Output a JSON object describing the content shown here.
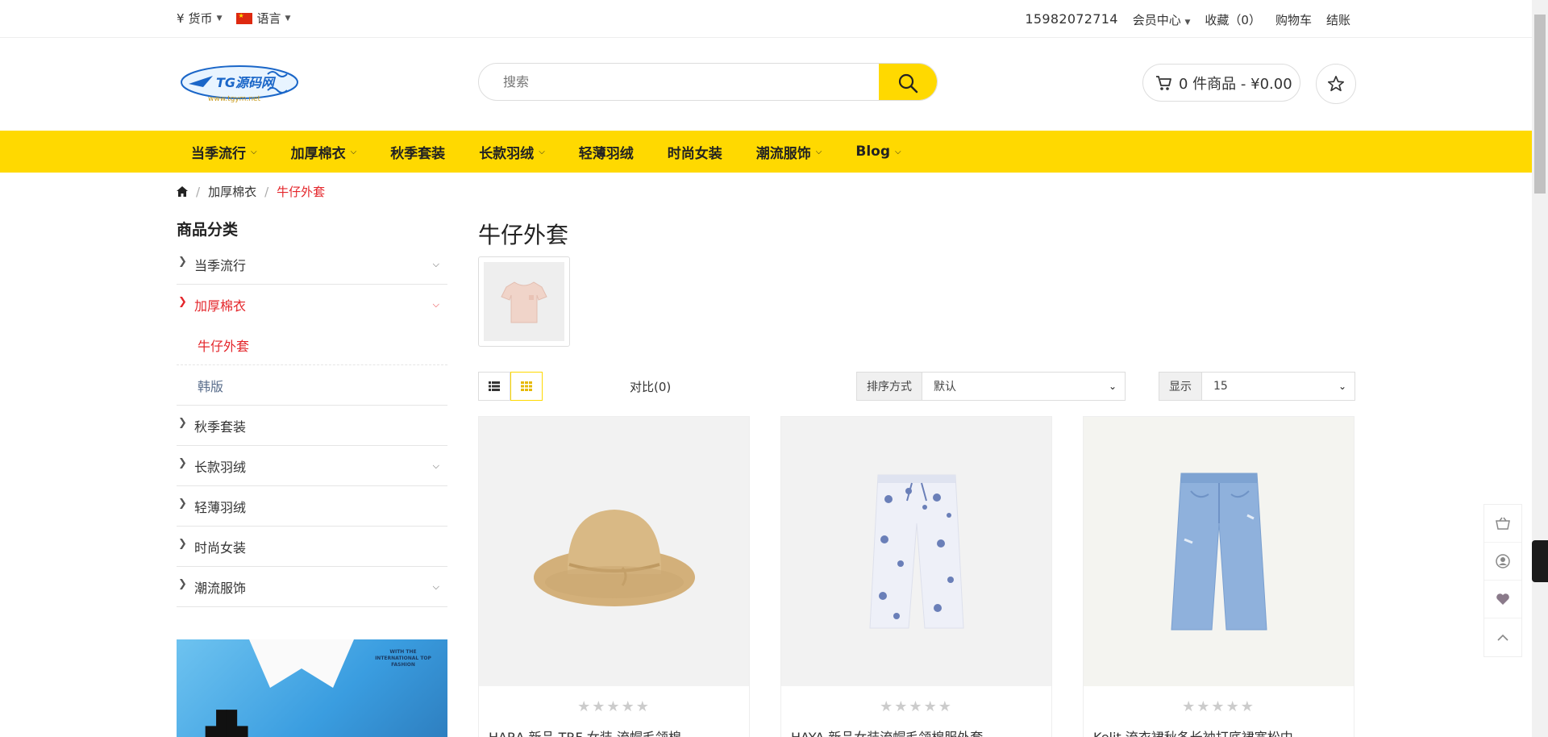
{
  "topbar": {
    "currency_symbol": "¥",
    "currency_label": "货币",
    "language_label": "语言",
    "phone": "15982072714",
    "member": "会员中心",
    "favorites": "收藏（0）",
    "cart": "购物车",
    "checkout": "结账"
  },
  "header": {
    "logo_text": "TG源码网",
    "logo_sub": "www.tgym.net",
    "search_placeholder": "搜索",
    "cart_summary": "0 件商品 - ¥0.00"
  },
  "nav": {
    "items": [
      {
        "label": "当季流行",
        "has_sub": true
      },
      {
        "label": "加厚棉衣",
        "has_sub": true
      },
      {
        "label": "秋季套装",
        "has_sub": false
      },
      {
        "label": "长款羽绒",
        "has_sub": true
      },
      {
        "label": "轻薄羽绒",
        "has_sub": false
      },
      {
        "label": "时尚女装",
        "has_sub": false
      },
      {
        "label": "潮流服饰",
        "has_sub": true
      },
      {
        "label": "Blog",
        "has_sub": true
      }
    ]
  },
  "breadcrumb": {
    "level1": "加厚棉衣",
    "level2": "牛仔外套"
  },
  "sidebar": {
    "title": "商品分类",
    "categories": [
      {
        "label": "当季流行"
      },
      {
        "label": "加厚棉衣"
      },
      {
        "label": "牛仔外套"
      },
      {
        "label": "韩版"
      },
      {
        "label": "秋季套装"
      },
      {
        "label": "长款羽绒"
      },
      {
        "label": "轻薄羽绒"
      },
      {
        "label": "时尚女装"
      },
      {
        "label": "潮流服饰"
      }
    ],
    "banner_text": "WITH THE INTERNATIONAL TOP FASHION"
  },
  "main": {
    "title": "牛仔外套",
    "compare": "对比(0)",
    "sort_label": "排序方式",
    "sort_value": "默认",
    "show_label": "显示",
    "show_value": "15",
    "products": [
      {
        "name": "HARA 新品 TRF 女装 流帽毛领棉"
      },
      {
        "name": "HAYA 新品女装流帽毛领棉服外套"
      },
      {
        "name": "Kelit 流衣裙秋冬长袖打底裙宽松中"
      }
    ],
    "stars": "★★★★★"
  },
  "colors": {
    "accent": "#ffd900",
    "active_red": "#e4262b"
  }
}
